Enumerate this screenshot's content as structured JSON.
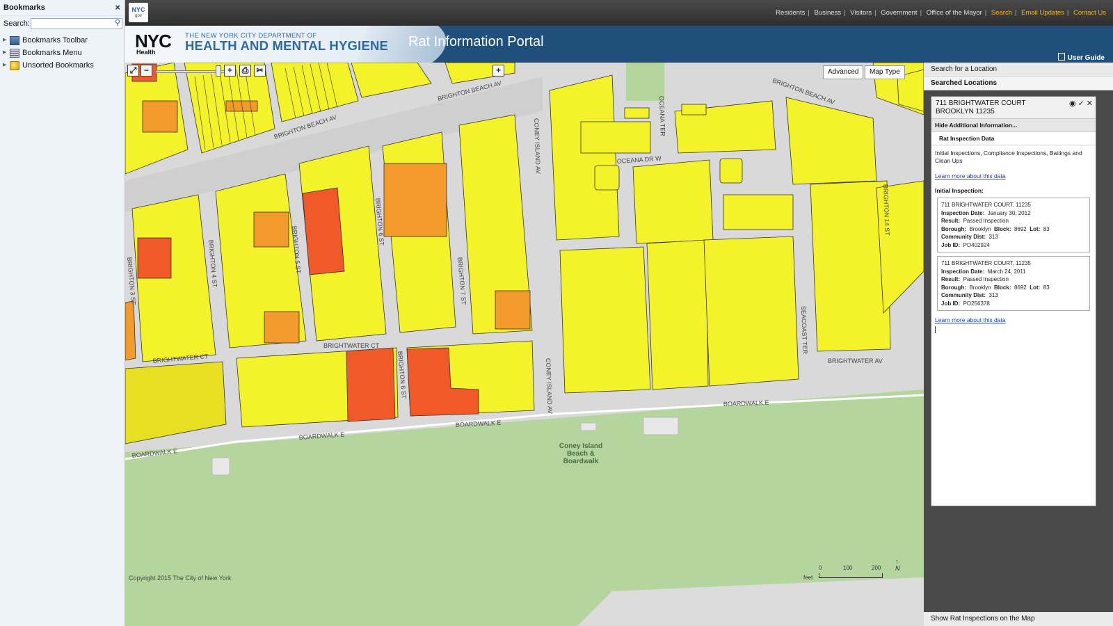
{
  "bookmarks": {
    "title": "Bookmarks",
    "close": "×",
    "search_label": "Search:",
    "items": [
      {
        "label": "Bookmarks Toolbar",
        "icon": "toolbar-folder-icon"
      },
      {
        "label": "Bookmarks Menu",
        "icon": "menu-folder-icon"
      },
      {
        "label": "Unsorted Bookmarks",
        "icon": "unsorted-folder-icon"
      }
    ]
  },
  "topbar": {
    "logo_main": "NYC",
    "logo_sub": "gov",
    "nav": [
      "Residents",
      "Business",
      "Visitors",
      "Government",
      "Office of the Mayor"
    ],
    "nav_highlight": [
      "Search",
      "Email Updates",
      "Contact Us"
    ],
    "highlight_color": "#f1b334"
  },
  "header": {
    "nyc": "NYC",
    "health": "Health",
    "dept_line1": "THE NEW YORK CITY DEPARTMENT OF",
    "dept_line2": "HEALTH AND MENTAL HYGIENE",
    "title": "Rat Information Portal",
    "user_guide": "User Guide",
    "bg_color": "#1f4f7a"
  },
  "map": {
    "buttons": {
      "advanced": "Advanced",
      "map_type": "Map Type"
    },
    "copyright": "Copyright 2015 The City of New York",
    "beach_label": [
      "Coney Island",
      "Beach &",
      "Boardwalk"
    ],
    "scale": {
      "unit": "feet",
      "ticks": [
        "0",
        "100",
        "200"
      ]
    },
    "north": "N",
    "streets": {
      "brighton_beach_av": "BRIGHTON BEACH AV",
      "brightwater_ct": "BRIGHTWATER CT",
      "brightwater_av": "BRIGHTWATER AV",
      "boardwalk_e": "BOARDWALK E",
      "coney_island_av": "CONEY ISLAND AV",
      "oceana_dr_w": "OCEANA DR W",
      "oceana_ter": "OCEANA TER",
      "seacoast_ter": "SEACOAST TER",
      "brighton_3_st": "BRIGHTON 3 ST",
      "brighton_4_st": "BRIGHTON 4 ST",
      "brighton_5_st": "BRIGHTON 5 ST",
      "brighton_6_st": "BRIGHTON 6 ST",
      "brighton_7_st": "BRIGHTON 7 ST",
      "brighton_14_st": "BRIGHTON 14 ST"
    },
    "colors": {
      "land": "#b5d59e",
      "street": "#d6d6d6",
      "passed": "#f4f22a",
      "moderate": "#f39a2c",
      "active": "#f05a28"
    }
  },
  "panel": {
    "search_location": "Search for a Location",
    "searched_locations": "Searched Locations",
    "show_inspections": "Show Rat Inspections on the Map",
    "address_line1": "711 BRIGHTWATER COURT",
    "address_line2": "BROOKLYN 11235",
    "hide_info": "Hide Additional Information...",
    "rat_data": "Rat Inspection Data",
    "description": "Initial Inspections, Compliance Inspections, Baitings and Clean Ups",
    "learn_more": "Learn more about this data",
    "initial_inspection": "Initial Inspection:",
    "inspections": [
      {
        "address": "711 BRIGHTWATER COURT,   11235",
        "date_label": "Inspection Date:",
        "date": "January 30, 2012",
        "result_label": "Result:",
        "result": "Passed Inspection",
        "borough_label": "Borough:",
        "borough": "Brooklyn",
        "block_label": "Block:",
        "block": "8692",
        "lot_label": "Lot:",
        "lot": "83",
        "cd_label": "Community Dist:",
        "cd": "313",
        "job_label": "Job ID:",
        "job": "PO402924"
      },
      {
        "address": "711 BRIGHTWATER COURT,   11235",
        "date_label": "Inspection Date:",
        "date": "March 24, 2011",
        "result_label": "Result:",
        "result": "Passed Inspection",
        "borough_label": "Borough:",
        "borough": "Brooklyn",
        "block_label": "Block:",
        "block": "8692",
        "lot_label": "Lot:",
        "lot": "83",
        "cd_label": "Community Dist:",
        "cd": "313",
        "job_label": "Job ID:",
        "job": "PO256378"
      }
    ]
  }
}
